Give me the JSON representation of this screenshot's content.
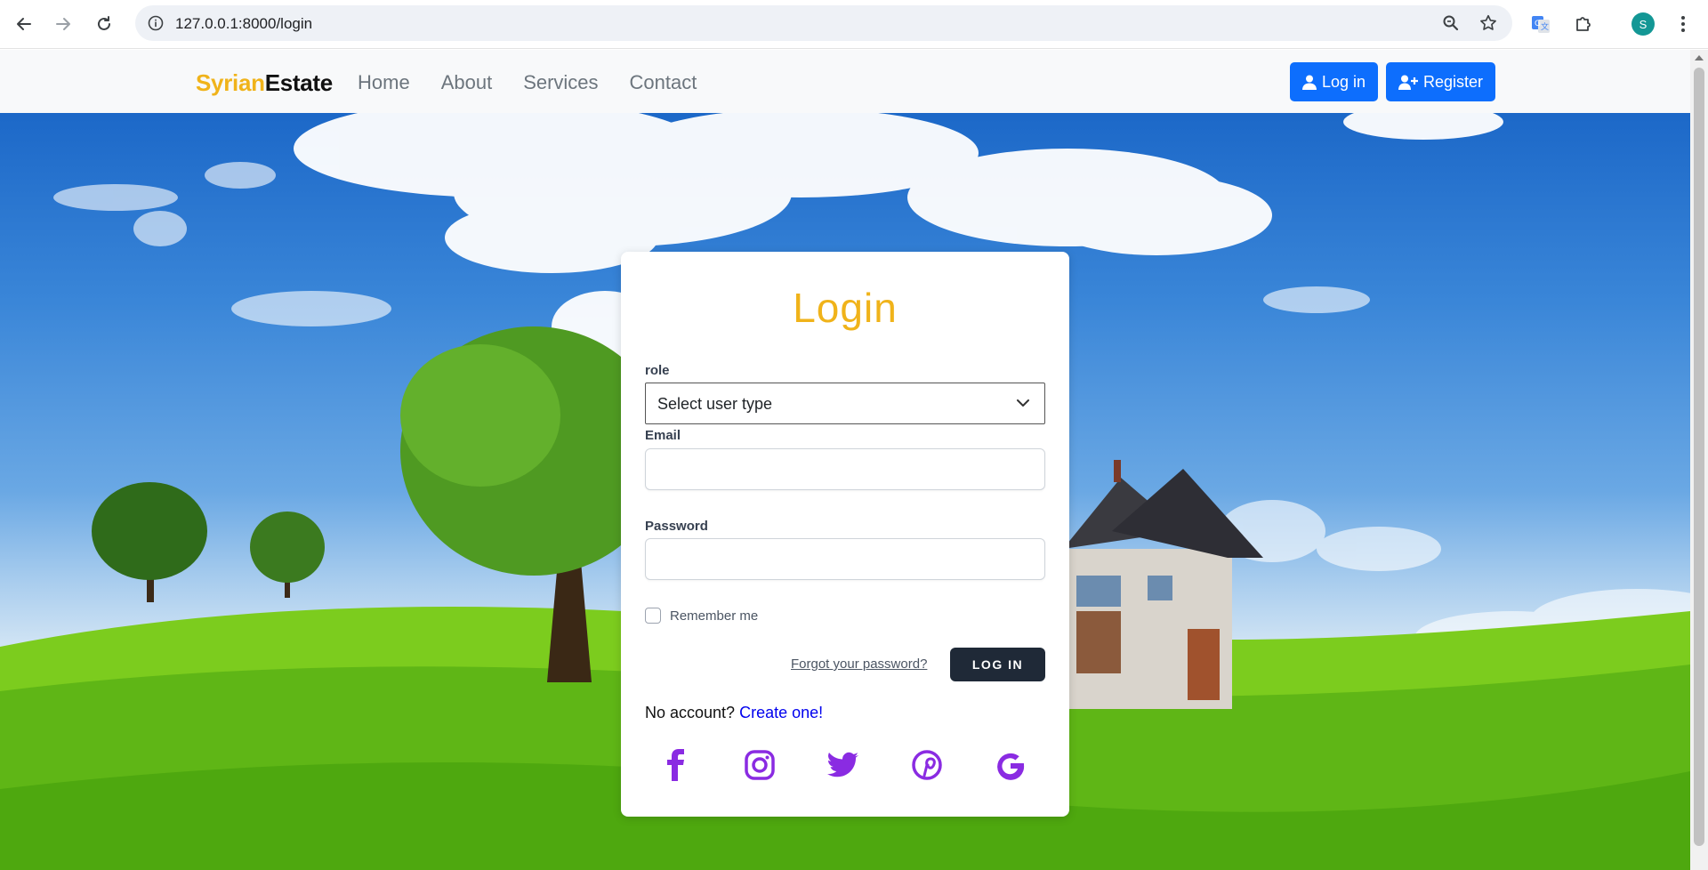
{
  "browser": {
    "url": "127.0.0.1:8000/login",
    "profile_initial": "S",
    "icons": {
      "back": "back-arrow-icon",
      "forward": "forward-arrow-icon",
      "reload": "reload-icon",
      "site_info": "info-icon",
      "zoom": "zoom-icon",
      "bookmark": "star-icon",
      "translate": "translate-icon",
      "extensions": "puzzle-icon",
      "menu": "kebab-menu-icon"
    }
  },
  "navbar": {
    "brand_part1": "Syrian",
    "brand_part2": "Estate",
    "links": [
      "Home",
      "About",
      "Services",
      "Contact"
    ],
    "login_label": "Log in",
    "register_label": "Register"
  },
  "login_form": {
    "title": "Login",
    "role_label": "role",
    "role_value": "Select user type",
    "email_label": "Email",
    "email_value": "",
    "password_label": "Password",
    "password_value": "",
    "remember_label": "Remember me",
    "remember_checked": false,
    "forgot_label": "Forgot your password?",
    "submit_label": "LOG IN",
    "no_account_text": "No account?",
    "create_label": "Create one!"
  },
  "socials": [
    "facebook-icon",
    "instagram-icon",
    "twitter-icon",
    "pinterest-icon",
    "google-icon"
  ],
  "colors": {
    "brand_accent": "#f0b31a",
    "primary_button": "#0d6efd",
    "dark_button": "#1f2937",
    "social_purple": "#8a2be2",
    "link_blue": "#0000ee"
  }
}
